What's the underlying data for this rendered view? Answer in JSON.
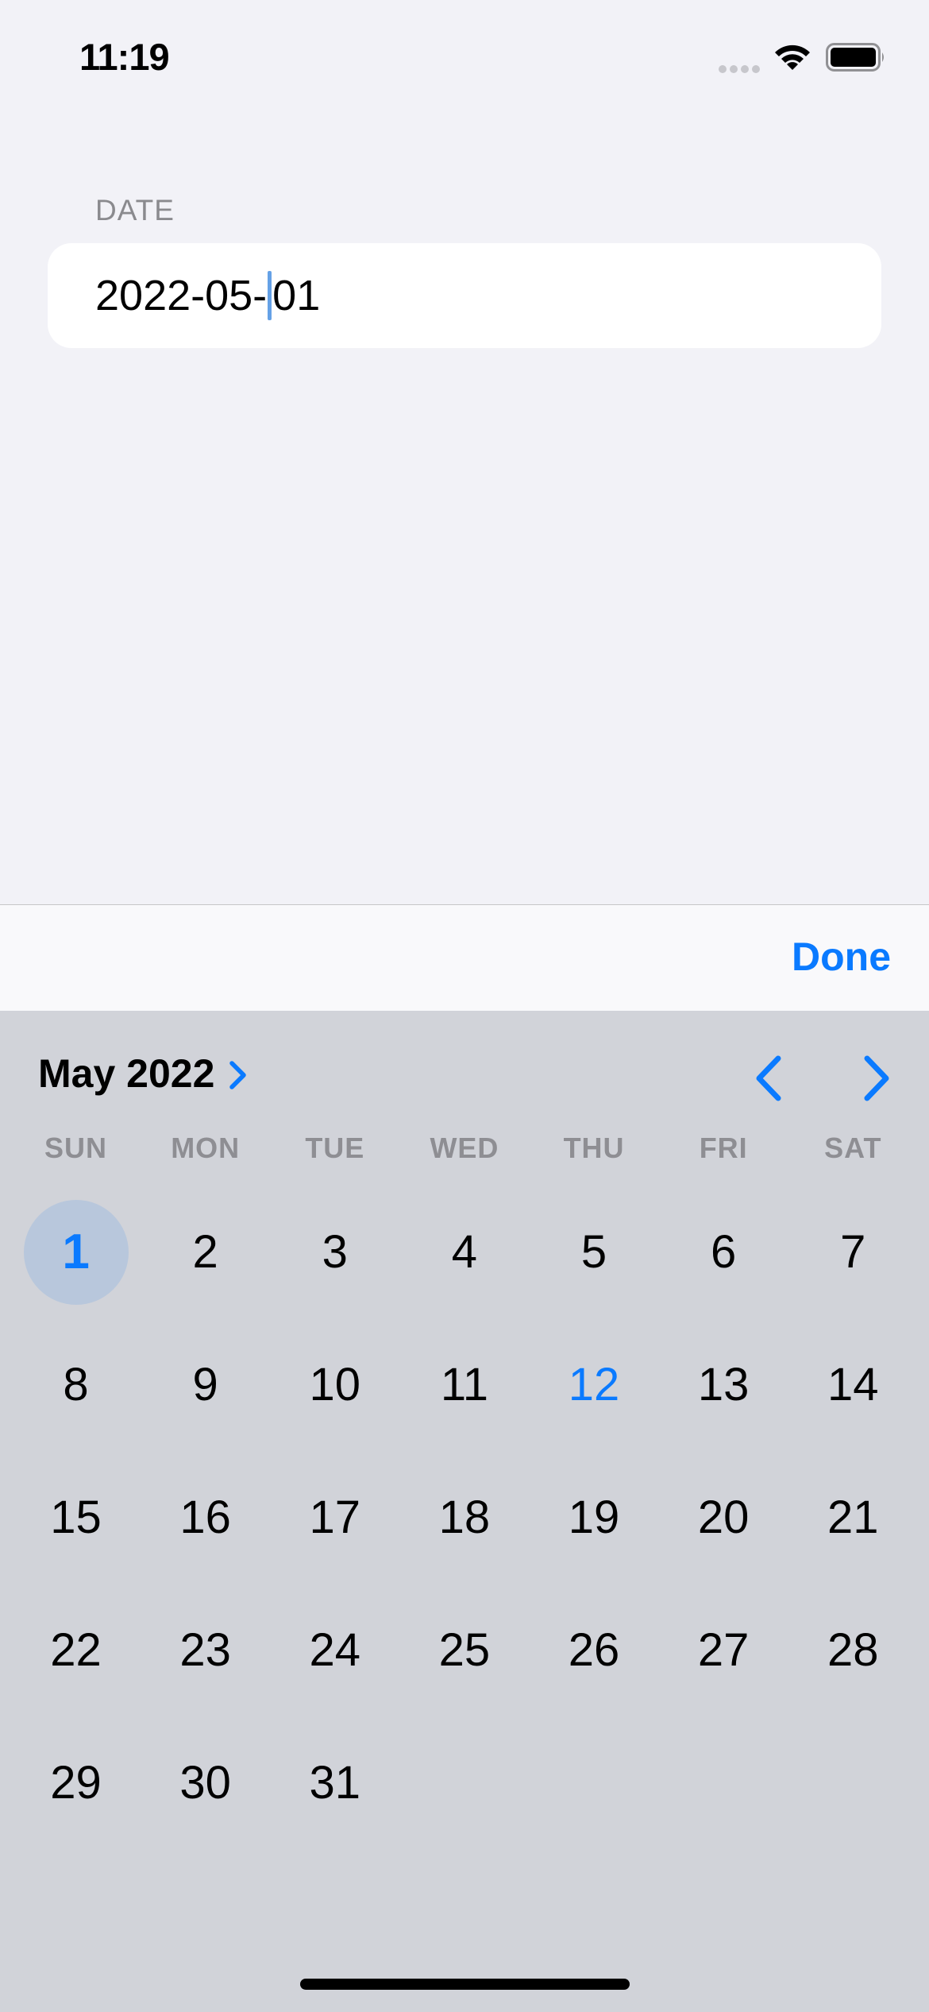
{
  "status_bar": {
    "time": "11:19",
    "icons": [
      "signal-icon",
      "wifi-icon",
      "battery-icon"
    ]
  },
  "form": {
    "section_label": "DATE",
    "date_value_before_cursor": "2022-05-",
    "date_value_after_cursor": "01"
  },
  "toolbar": {
    "done_label": "Done"
  },
  "picker": {
    "month_label": "May 2022",
    "weekdays": [
      "SUN",
      "MON",
      "TUE",
      "WED",
      "THU",
      "FRI",
      "SAT"
    ],
    "days": [
      "1",
      "2",
      "3",
      "4",
      "5",
      "6",
      "7",
      "8",
      "9",
      "10",
      "11",
      "12",
      "13",
      "14",
      "15",
      "16",
      "17",
      "18",
      "19",
      "20",
      "21",
      "22",
      "23",
      "24",
      "25",
      "26",
      "27",
      "28",
      "29",
      "30",
      "31",
      "",
      "",
      "",
      ""
    ],
    "selected_day": "1",
    "today_day": "12"
  },
  "colors": {
    "accent": "#0a7aff",
    "background": "#f2f2f7",
    "picker_background": "#d1d3d9",
    "selected_circle": "#b8c7dc"
  }
}
